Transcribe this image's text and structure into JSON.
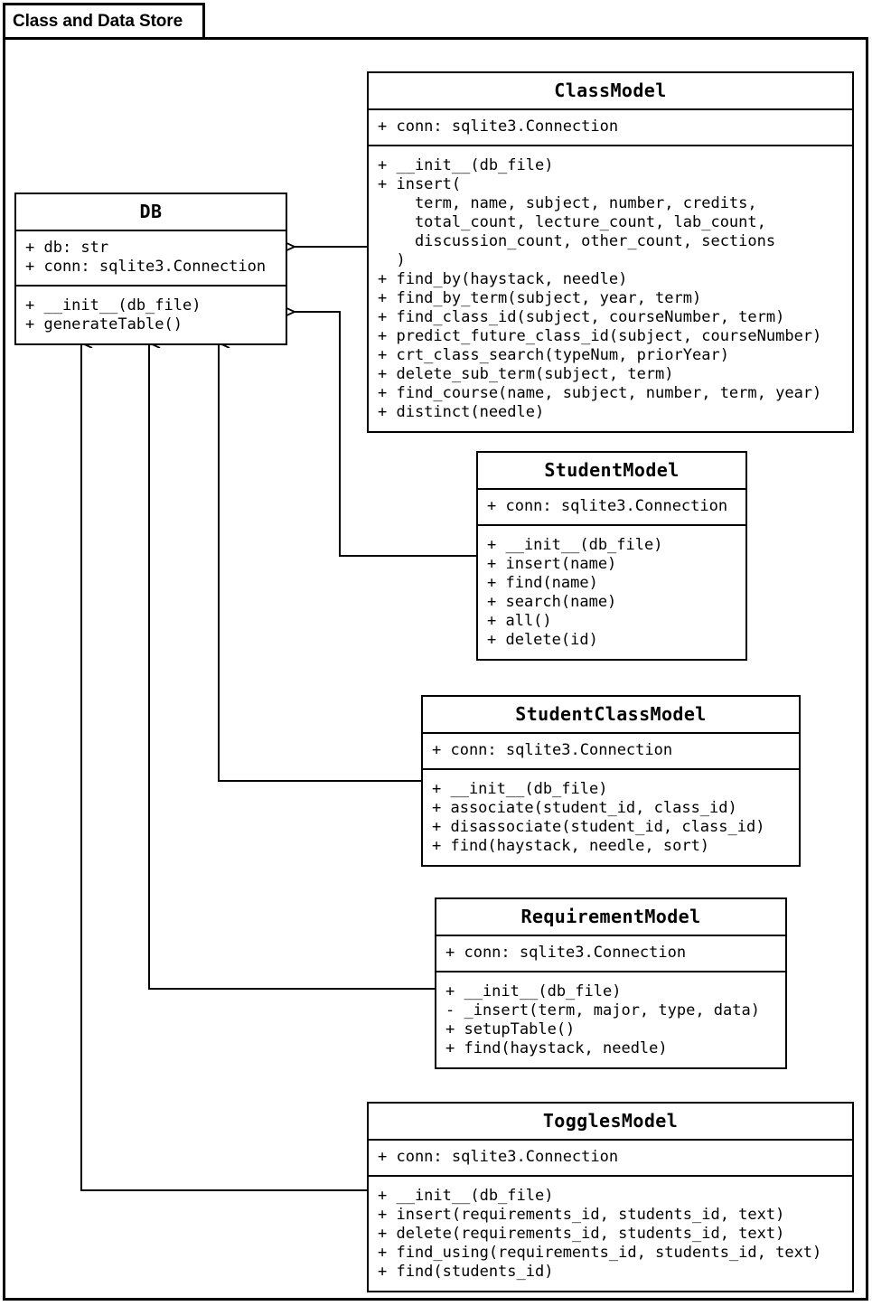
{
  "package": {
    "title": "Class and Data Store"
  },
  "classes": [
    {
      "id": "db",
      "name": "DB",
      "attributes": [
        "+ db: str",
        "+ conn: sqlite3.Connection"
      ],
      "operations": [
        "+ __init__(db_file)",
        "+ generateTable()"
      ]
    },
    {
      "id": "class-model",
      "name": "ClassModel",
      "attributes": [
        "+ conn: sqlite3.Connection"
      ],
      "operations": [
        "+ __init__(db_file)",
        "+ insert(",
        "    term, name, subject, number, credits,",
        "    total_count, lecture_count, lab_count,",
        "    discussion_count, other_count, sections",
        "  )",
        "+ find_by(haystack, needle)",
        "+ find_by_term(subject, year, term)",
        "+ find_class_id(subject, courseNumber, term)",
        "+ predict_future_class_id(subject, courseNumber)",
        "+ crt_class_search(typeNum, priorYear)",
        "+ delete_sub_term(subject, term)",
        "+ find_course(name, subject, number, term, year)",
        "+ distinct(needle)"
      ]
    },
    {
      "id": "student-model",
      "name": "StudentModel",
      "attributes": [
        "+ conn: sqlite3.Connection"
      ],
      "operations": [
        "+ __init__(db_file)",
        "+ insert(name)",
        "+ find(name)",
        "+ search(name)",
        "+ all()",
        "+ delete(id)"
      ]
    },
    {
      "id": "student-class-model",
      "name": "StudentClassModel",
      "attributes": [
        "+ conn: sqlite3.Connection"
      ],
      "operations": [
        "+ __init__(db_file)",
        "+ associate(student_id, class_id)",
        "+ disassociate(student_id, class_id)",
        "+ find(haystack, needle, sort)"
      ]
    },
    {
      "id": "requirement-model",
      "name": "RequirementModel",
      "attributes": [
        "+ conn: sqlite3.Connection"
      ],
      "operations": [
        "+ __init__(db_file)",
        "- _insert(term, major, type, data)",
        "+ setupTable()",
        "+ find(haystack, needle)"
      ]
    },
    {
      "id": "toggles-model",
      "name": "TogglesModel",
      "attributes": [
        "+ conn: sqlite3.Connection"
      ],
      "operations": [
        "+ __init__(db_file)",
        "+ insert(requirements_id, students_id, text)",
        "+ delete(requirements_id, students_id, text)",
        "+ find_using(requirements_id, students_id, text)",
        "+ find(students_id)"
      ]
    }
  ],
  "relations": [
    {
      "from": "class-model",
      "to": "db",
      "type": "dependency-arrow"
    },
    {
      "from": "student-model",
      "to": "db",
      "type": "dependency-arrow"
    },
    {
      "from": "student-class-model",
      "to": "db",
      "type": "dependency-arrow"
    },
    {
      "from": "requirement-model",
      "to": "db",
      "type": "dependency-arrow"
    },
    {
      "from": "toggles-model",
      "to": "db",
      "type": "dependency-arrow"
    }
  ],
  "style": {
    "line_color": "#000000",
    "background": "#ffffff"
  }
}
